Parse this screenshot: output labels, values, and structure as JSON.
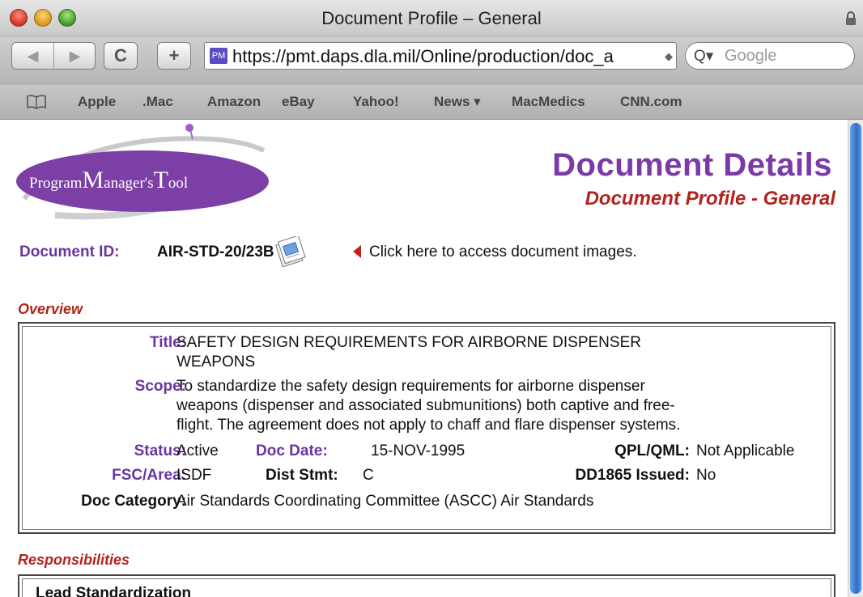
{
  "window": {
    "title": "Document Profile – General"
  },
  "toolbar": {
    "back_glyph": "◀",
    "forward_glyph": "▶",
    "reload_glyph": "C",
    "add_glyph": "+",
    "favicon_text": "PM",
    "url": "https://pmt.daps.dla.mil/Online/production/doc_a",
    "search_placeholder": "Google",
    "search_glyph": "Q▾"
  },
  "bookmarks": [
    "Apple",
    ".Mac",
    "Amazon",
    "eBay",
    "Yahoo!",
    "News ▾",
    "MacMedics",
    "CNN.com"
  ],
  "header": {
    "logo_p": "P",
    "logo_rogram": "rogram",
    "logo_m": "M",
    "logo_anagers": "anager's",
    "logo_t": "T",
    "logo_ool": "ool",
    "title": "Document Details",
    "subtitle": "Document Profile - General"
  },
  "document": {
    "id_label": "Document ID:",
    "id_value": "AIR-STD-20/23B",
    "images_link": "Click here to access document images."
  },
  "overview": {
    "heading": "Overview",
    "title_label": "Title:",
    "title_line1": "SAFETY DESIGN REQUIREMENTS FOR AIRBORNE DISPENSER",
    "title_line2": "WEAPONS",
    "scope_label": "Scope:",
    "scope_line1": "To standardize the safety design requirements for airborne dispenser",
    "scope_line2": "weapons (dispenser and associated submunitions) both captive and free-",
    "scope_line3": "flight. The agreement does not apply to chaff and flare dispenser systems.",
    "status_label": "Status:",
    "status_value": "Active",
    "docdate_label": "Doc Date:",
    "docdate_value": "15-NOV-1995",
    "qpl_label": "QPL/QML:",
    "qpl_value": "Not Applicable",
    "fsc_label": "FSC/Area:",
    "fsc_value": "ISDF",
    "dist_label": "Dist Stmt:",
    "dist_value": "C",
    "dd1865_label": "DD1865 Issued:",
    "dd1865_value": "No",
    "category_label": "Doc Category:",
    "category_value": "Air Standards Coordinating Committee (ASCC) Air Standards"
  },
  "responsibilities": {
    "heading": "Responsibilities",
    "lead_label": "Lead Standardization"
  }
}
